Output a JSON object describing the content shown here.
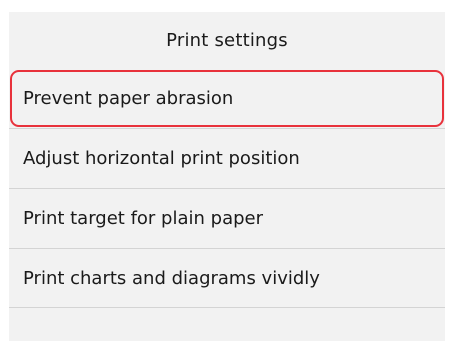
{
  "screen": {
    "title": "Print settings"
  },
  "menu": {
    "items": [
      {
        "label": "Prevent paper abrasion",
        "selected": true
      },
      {
        "label": "Adjust horizontal print position",
        "selected": false
      },
      {
        "label": "Print target for plain paper",
        "selected": false
      },
      {
        "label": "Print charts and diagrams vividly",
        "selected": false
      }
    ]
  },
  "colors": {
    "background": "#f2f2f2",
    "divider": "#d4d4d4",
    "selection_highlight": "#e8323c"
  }
}
